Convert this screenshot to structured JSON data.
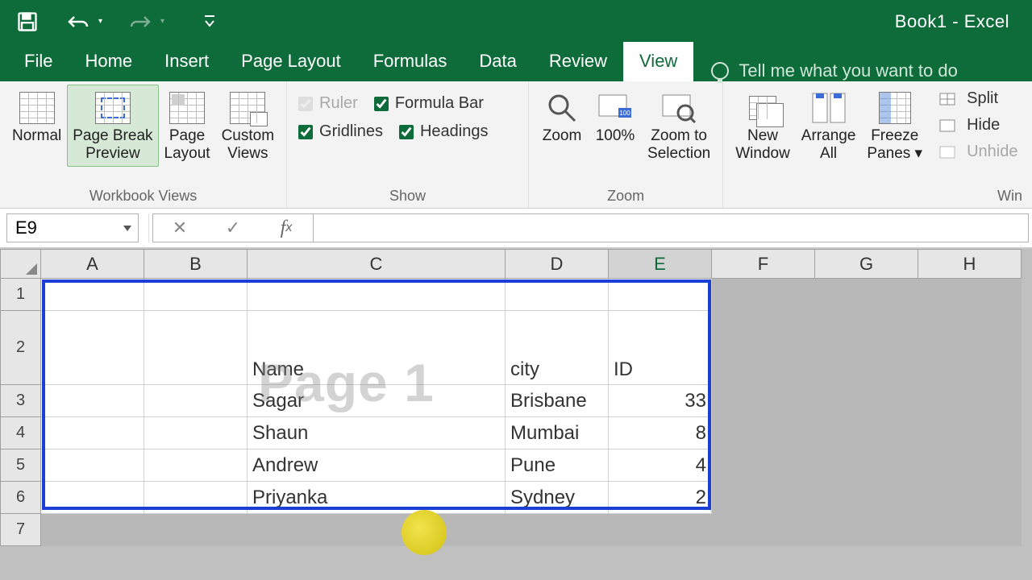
{
  "title": "Book1 - Excel",
  "tabs": [
    "File",
    "Home",
    "Insert",
    "Page Layout",
    "Formulas",
    "Data",
    "Review",
    "View"
  ],
  "active_tab": "View",
  "tellme_placeholder": "Tell me what you want to do",
  "ribbon": {
    "group_views": "Workbook Views",
    "group_show": "Show",
    "group_zoom": "Zoom",
    "group_win_short": "Win",
    "normal": "Normal",
    "page_break_preview": "Page Break\nPreview",
    "page_layout": "Page\nLayout",
    "custom_views": "Custom\nViews",
    "ruler": "Ruler",
    "formula_bar": "Formula Bar",
    "gridlines": "Gridlines",
    "headings": "Headings",
    "zoom": "Zoom",
    "zoom100": "100%",
    "zoom_selection": "Zoom to\nSelection",
    "new_window": "New\nWindow",
    "arrange_all": "Arrange\nAll",
    "freeze_panes": "Freeze\nPanes",
    "split": "Split",
    "hide": "Hide",
    "unhide": "Unhide"
  },
  "namebox": "E9",
  "formula": "",
  "columns": [
    "A",
    "B",
    "C",
    "D",
    "E",
    "F",
    "G",
    "H"
  ],
  "selected_col": "E",
  "rows": [
    "1",
    "2",
    "3",
    "4",
    "5",
    "6",
    "7"
  ],
  "watermark": "Page 1",
  "data": {
    "headers": {
      "name": "Name",
      "city": "city",
      "id": "ID"
    },
    "records": [
      {
        "name": "Sagar",
        "city": "Brisbane",
        "id": "33"
      },
      {
        "name": "Shaun",
        "city": "Mumbai",
        "id": "8"
      },
      {
        "name": "Andrew",
        "city": "Pune",
        "id": "4"
      },
      {
        "name": "Priyanka",
        "city": "Sydney",
        "id": "2"
      }
    ]
  }
}
